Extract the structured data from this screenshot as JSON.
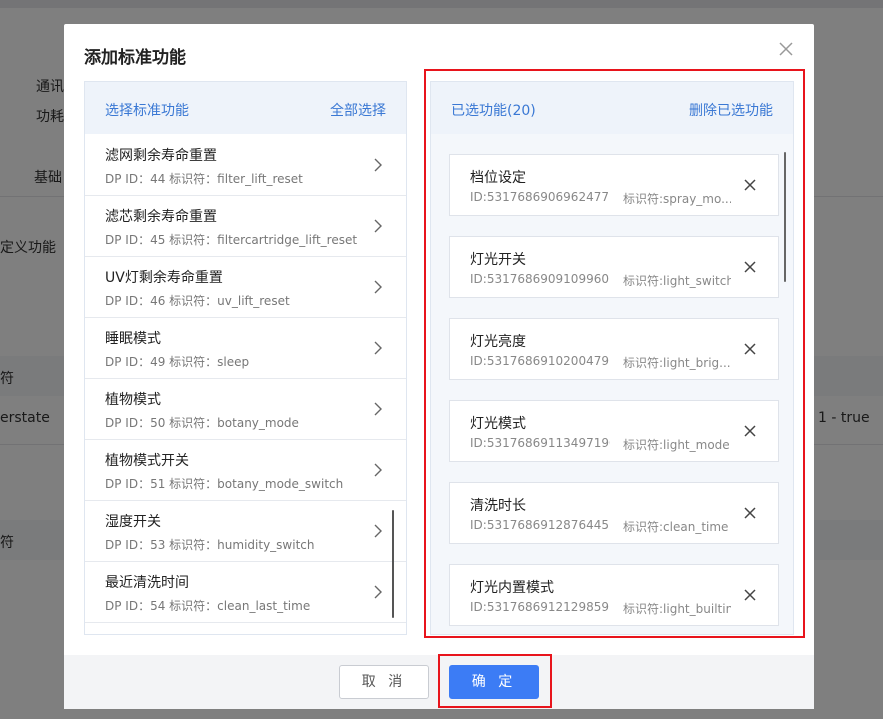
{
  "background": {
    "labels": [
      "通讯",
      "功耗",
      "基础",
      "定义功能",
      "符",
      "erstate",
      "1 - true",
      "符"
    ]
  },
  "modal": {
    "title": "添加标准功能",
    "left_panel": {
      "title": "选择标准功能",
      "action": "全部选择",
      "items": [
        {
          "name": "滤网剩余寿命重置",
          "dp": "DP ID：44",
          "code": "标识符：filter_lift_reset"
        },
        {
          "name": "滤芯剩余寿命重置",
          "dp": "DP ID：45",
          "code": "标识符：filtercartridge_lift_reset"
        },
        {
          "name": "UV灯剩余寿命重置",
          "dp": "DP ID：46",
          "code": "标识符：uv_lift_reset"
        },
        {
          "name": "睡眠模式",
          "dp": "DP ID：49",
          "code": "标识符：sleep"
        },
        {
          "name": "植物模式",
          "dp": "DP ID：50",
          "code": "标识符：botany_mode"
        },
        {
          "name": "植物模式开关",
          "dp": "DP ID：51",
          "code": "标识符：botany_mode_switch"
        },
        {
          "name": "湿度开关",
          "dp": "DP ID：53",
          "code": "标识符：humidity_switch"
        },
        {
          "name": "最近清洗时间",
          "dp": "DP ID：54",
          "code": "标识符：clean_last_time"
        }
      ]
    },
    "right_panel": {
      "title": "已选功能(20)",
      "action": "删除已选功能",
      "items": [
        {
          "name": "档位设定",
          "id": "ID:5317686906962477...",
          "code": "标识符:spray_mo..."
        },
        {
          "name": "灯光开关",
          "id": "ID:5317686909109960...",
          "code": "标识符:light_switch"
        },
        {
          "name": "灯光亮度",
          "id": "ID:5317686910200479...",
          "code": "标识符:light_brig..."
        },
        {
          "name": "灯光模式",
          "id": "ID:5317686911349719​0...",
          "code": "标识符:light_mode"
        },
        {
          "name": "清洗时长",
          "id": "ID:5317686912876445...",
          "code": "标识符:clean_time"
        },
        {
          "name": "灯光内置模式",
          "id": "ID:5317686912129859...",
          "code": "标识符:light_builtin"
        }
      ]
    },
    "buttons": {
      "cancel": "取 消",
      "ok": "确 定"
    }
  },
  "colors": {
    "accent": "#3c7cf5",
    "link": "#3a78d4",
    "highlight": "#e8141c"
  }
}
